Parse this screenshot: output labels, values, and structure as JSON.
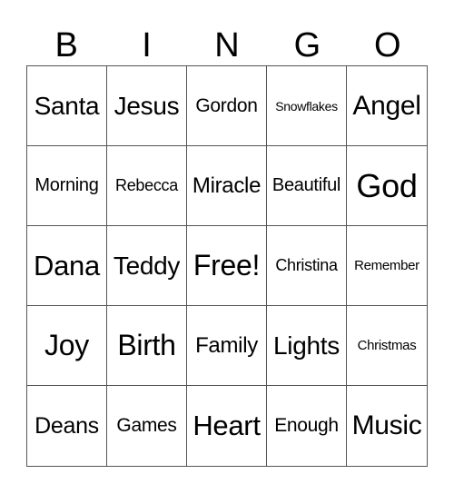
{
  "header": [
    "B",
    "I",
    "N",
    "G",
    "O"
  ],
  "cells": [
    [
      "Santa",
      "Jesus",
      "Gordon",
      "Snowflakes",
      "Angel"
    ],
    [
      "Morning",
      "Rebecca",
      "Miracle",
      "Beautiful",
      "God"
    ],
    [
      "Dana",
      "Teddy",
      "Free!",
      "Christina",
      "Remember"
    ],
    [
      "Joy",
      "Birth",
      "Family",
      "Lights",
      "Christmas"
    ],
    [
      "Deans",
      "Games",
      "Heart",
      "Enough",
      "Music"
    ]
  ]
}
